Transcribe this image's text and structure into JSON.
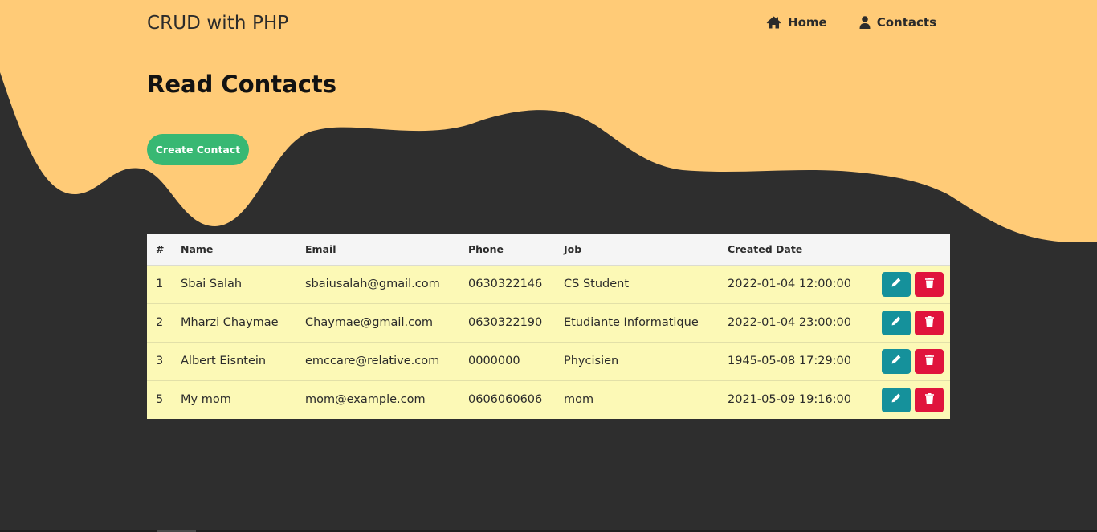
{
  "brand": "CRUD with PHP",
  "nav": {
    "home_label": "Home",
    "contacts_label": "Contacts"
  },
  "page_title": "Read Contacts",
  "create_button_label": "Create Contact",
  "colors": {
    "header_bg": "#ffcb77",
    "body_bg": "#2e2e2e",
    "row_bg": "#fcf9b6",
    "create_button": "#38b873",
    "edit_button": "#15919b",
    "delete_button": "#e0143c"
  },
  "table": {
    "headers": [
      "#",
      "Name",
      "Email",
      "Phone",
      "Job",
      "Created Date",
      ""
    ],
    "rows": [
      {
        "id": "1",
        "name": "Sbai Salah",
        "email": "sbaiusalah@gmail.com",
        "phone": "0630322146",
        "job": "CS Student",
        "created": "2022-01-04 12:00:00"
      },
      {
        "id": "2",
        "name": "Mharzi Chaymae",
        "email": "Chaymae@gmail.com",
        "phone": "0630322190",
        "job": "Etudiante Informatique",
        "created": "2022-01-04 23:00:00"
      },
      {
        "id": "3",
        "name": "Albert Eisntein",
        "email": "emccare@relative.com",
        "phone": "0000000",
        "job": "Phycisien",
        "created": "1945-05-08 17:29:00"
      },
      {
        "id": "5",
        "name": "My mom",
        "email": "mom@example.com",
        "phone": "0606060606",
        "job": "mom",
        "created": "2021-05-09 19:16:00"
      }
    ],
    "row_actions": [
      "pencil-icon",
      "trash-icon"
    ]
  },
  "icons": {
    "home": "home-icon",
    "contacts": "user-icon"
  }
}
